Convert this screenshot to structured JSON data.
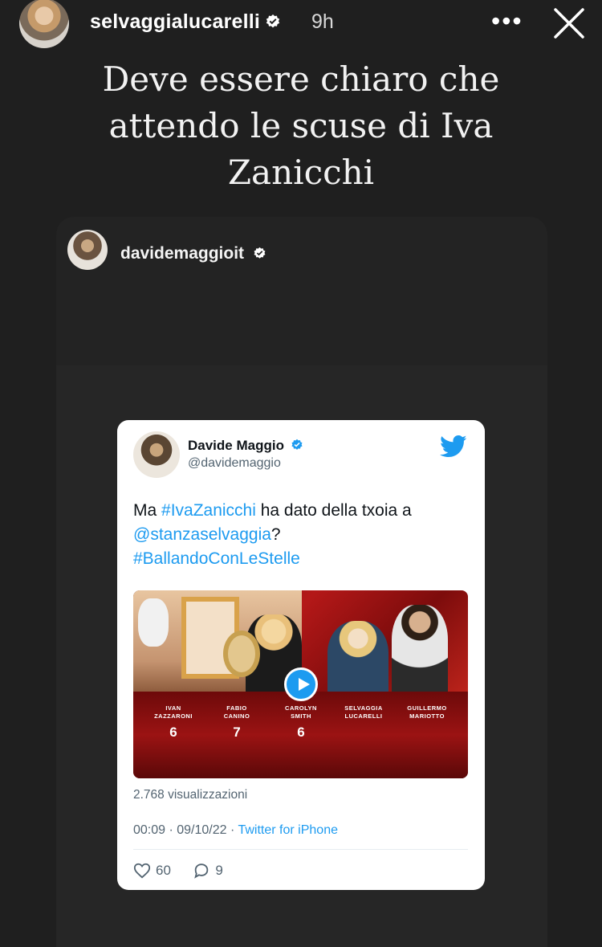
{
  "story": {
    "username": "selvaggialucarelli",
    "time": "9h",
    "more_label": "•••",
    "caption": "Deve essere chiaro che attendo le scuse di Iva Zanicchi"
  },
  "shared_post": {
    "username": "davidemaggioit"
  },
  "tweet": {
    "name": "Davide Maggio",
    "handle": "@davidemaggio",
    "text_prefix": "Ma ",
    "hashtag1": "#IvaZanicchi",
    "text_middle": " ha dato della txoia a ",
    "mention": "@stanzaselvaggia",
    "text_question": "?",
    "hashtag2": "#BallandoConLeStelle",
    "views": "2.768 visualizzazioni",
    "time": "00:09 · 09/10/22",
    "source": "Twitter for iPhone",
    "likes": "60",
    "replies": "9"
  },
  "video": {
    "judges": [
      {
        "name_line1": "IVAN",
        "name_line2": "ZAZZARONI",
        "score": "6"
      },
      {
        "name_line1": "FABIO",
        "name_line2": "CANINO",
        "score": "7"
      },
      {
        "name_line1": "CAROLYN",
        "name_line2": "SMITH",
        "score": "6"
      },
      {
        "name_line1": "SELVAGGIA",
        "name_line2": "LUCARELLI",
        "score": ""
      },
      {
        "name_line1": "GUILLERMO",
        "name_line2": "MARIOTTO",
        "score": ""
      }
    ]
  },
  "colors": {
    "background": "#1f1f1f",
    "twitter_blue": "#1d9bf0"
  }
}
